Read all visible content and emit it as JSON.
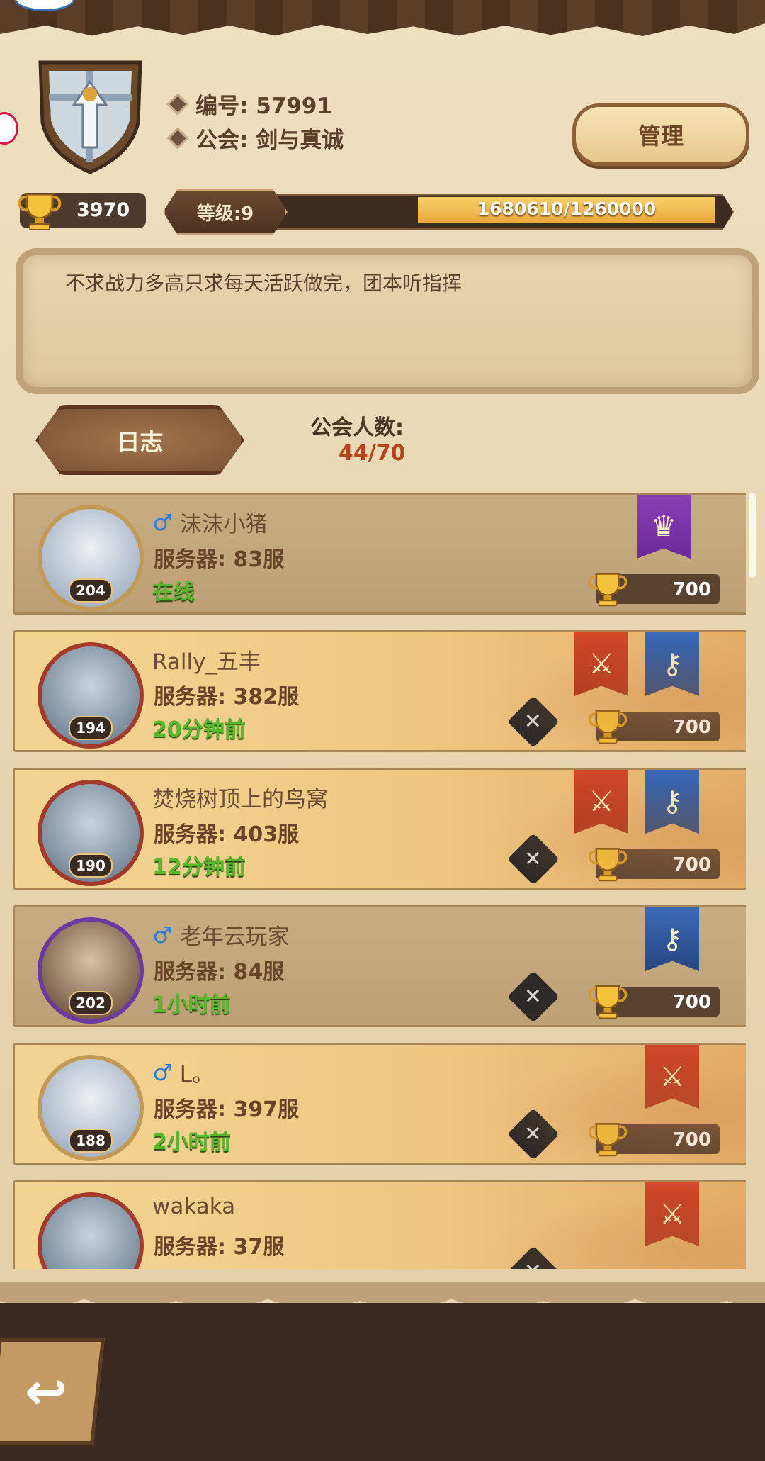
{
  "guild": {
    "id_label": "编号: 57991",
    "name_label": "公会: 剑与真诚",
    "manage_label": "管理",
    "trophy_value": "3970",
    "level_label": "等级:9",
    "exp_text": "1680610/1260000",
    "notice": "不求战力多高只求每天活跃做完，团本听指挥",
    "log_label": "日志",
    "member_count_label": "公会人数:",
    "member_count": "44/70"
  },
  "members": [
    {
      "name": "沫沫小猪",
      "male": true,
      "server": "服务器: 83服",
      "status": "在线",
      "level": "204",
      "trophy": "700",
      "banners": [
        "purple"
      ],
      "swords": false
    },
    {
      "name": "Rally_五丰",
      "male": false,
      "server": "服务器: 382服",
      "status": "20分钟前",
      "level": "194",
      "trophy": "700",
      "banners": [
        "red",
        "blue"
      ],
      "swords": true
    },
    {
      "name": "焚烧树顶上的鸟窝",
      "male": false,
      "server": "服务器: 403服",
      "status": "12分钟前",
      "level": "190",
      "trophy": "700",
      "banners": [
        "red",
        "blue"
      ],
      "swords": true
    },
    {
      "name": "老年云玩家",
      "male": true,
      "server": "服务器: 84服",
      "status": "1小时前",
      "level": "202",
      "trophy": "700",
      "banners": [
        "blue"
      ],
      "swords": true
    },
    {
      "name": "L。",
      "male": true,
      "server": "服务器: 397服",
      "status": "2小时前",
      "level": "188",
      "trophy": "700",
      "banners": [
        "red"
      ],
      "swords": true
    },
    {
      "name": "wakaka",
      "male": false,
      "server": "服务器: 37服",
      "status": "",
      "level": "",
      "trophy": "",
      "banners": [
        "red"
      ],
      "swords": true
    }
  ],
  "icons": {
    "back": "back-arrow-icon",
    "trophy": "trophy-icon",
    "male": "male-icon",
    "swords": "crossed-swords-icon"
  },
  "colors": {
    "online": "#5ab82c",
    "accent": "#b4451c"
  }
}
